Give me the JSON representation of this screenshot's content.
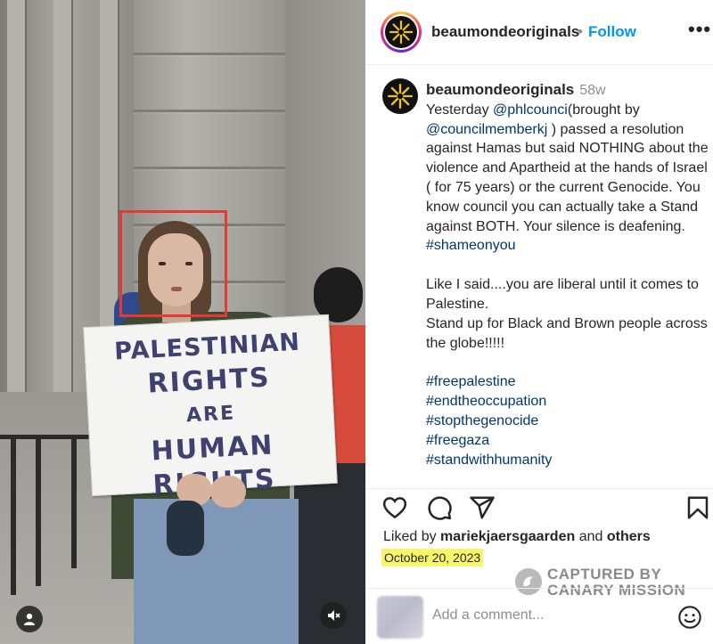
{
  "photo": {
    "sign_lines": [
      "PALESTINIAN",
      "RIGHTS",
      "ARE",
      "HUMAN",
      "RIGHTS"
    ],
    "buttons": {
      "profile": "user-icon",
      "mute": "muted-speaker-icon"
    }
  },
  "header": {
    "username": "beaumondeoriginals",
    "separator": "•",
    "follow_label": "Follow",
    "more_label": "•••"
  },
  "caption": {
    "username": "beaumondeoriginals",
    "time": "58w",
    "paragraphs": [
      [
        "Yesterday ",
        "@phlcounci",
        "(brought by ",
        "@councilmemberkj",
        " ) passed a resolution against Hamas but said NOTHING about the violence and Apartheid at the hands of Israel ( for 75 years) or the current Genocide. You know council you can actually take a Stand against BOTH. Your silence is deafening. ",
        "#shameonyou"
      ],
      "Like I said....you are liberal until it comes to Palestine.",
      "Stand up for Black and Brown people across the globe!!!!!"
    ],
    "hashtags": [
      "#freepalestine",
      "#endtheoccupation",
      "#stopthegenocide",
      "#freegaza",
      "#standwithhumanity"
    ]
  },
  "actions": {
    "like": "heart-icon",
    "comment": "comment-icon",
    "share": "share-icon",
    "save": "bookmark-icon"
  },
  "likes": {
    "prefix": "Liked by",
    "user": "mariekjaersgaarden",
    "and": "and",
    "others": "others"
  },
  "date": "October 20, 2023",
  "watermark": {
    "line1": "CAPTURED BY",
    "line2": "CANARY MISSION"
  },
  "comment_box": {
    "placeholder": "Add a comment..."
  },
  "colors": {
    "link": "#0095f6",
    "hashtag": "#00376b",
    "highlight": "#f7f56a",
    "box": "#e53935"
  }
}
